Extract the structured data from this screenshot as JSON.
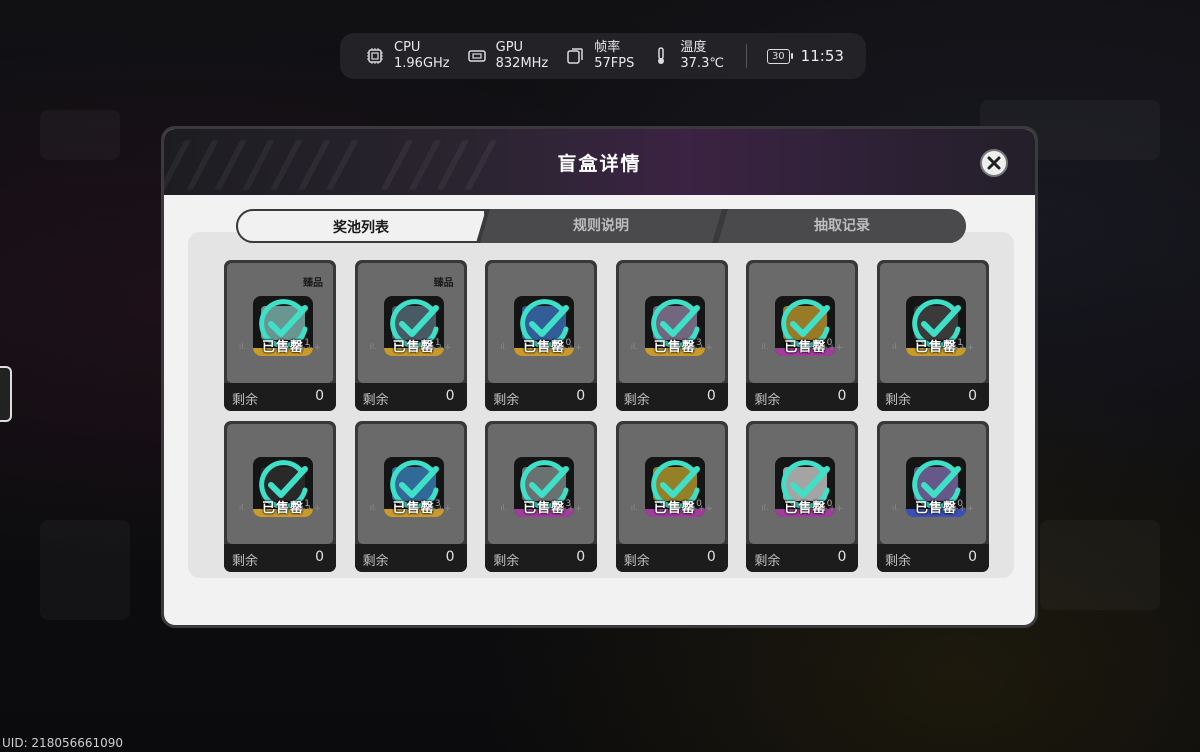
{
  "hud": {
    "cpu": {
      "label": "CPU",
      "value": "1.96GHz",
      "icon": "cpu-icon"
    },
    "gpu": {
      "label": "GPU",
      "value": "832MHz",
      "icon": "gpu-icon"
    },
    "fps": {
      "label": "帧率",
      "value": "57FPS",
      "icon": "fps-icon"
    },
    "temp": {
      "label": "温度",
      "value": "37.3℃",
      "icon": "thermometer-icon"
    },
    "battery": "30",
    "time": "11:53"
  },
  "dialog": {
    "title": "盲盒详情",
    "tabs": [
      "奖池列表",
      "规则说明",
      "抽取记录"
    ],
    "active_tab": "奖池列表",
    "remain_label": "剩余",
    "sold_label": "已售罄",
    "featured_badge": "臻品",
    "items": [
      {
        "badge": true,
        "remaining": "0",
        "color": "#7fb7b0",
        "bar": "#c99b2a",
        "level": "1"
      },
      {
        "badge": true,
        "remaining": "0",
        "color": "#556b77",
        "bar": "#c99b2a",
        "level": "1"
      },
      {
        "badge": false,
        "remaining": "0",
        "color": "#3a6fb8",
        "bar": "#c99b2a",
        "level": "0"
      },
      {
        "badge": false,
        "remaining": "0",
        "color": "#8a7c9a",
        "bar": "#c99b2a",
        "level": "3"
      },
      {
        "badge": false,
        "remaining": "0",
        "color": "#b9932c",
        "bar": "#a03c9c",
        "level": "0"
      },
      {
        "badge": false,
        "remaining": "0",
        "color": "#444444",
        "bar": "#c99b2a",
        "level": "1"
      },
      {
        "badge": false,
        "remaining": "0",
        "color": "#2e2e2e",
        "bar": "#c99b2a",
        "level": "1"
      },
      {
        "badge": false,
        "remaining": "0",
        "color": "#3a7fb8",
        "bar": "#c99b2a",
        "level": "3"
      },
      {
        "badge": false,
        "remaining": "0",
        "color": "#7f8a88",
        "bar": "#a03c9c",
        "level": "3"
      },
      {
        "badge": false,
        "remaining": "0",
        "color": "#b59a2c",
        "bar": "#a03c9c",
        "level": "0"
      },
      {
        "badge": false,
        "remaining": "0",
        "color": "#c8c8c8",
        "bar": "#a03c9c",
        "level": "0"
      },
      {
        "badge": false,
        "remaining": "0",
        "color": "#7a6aa8",
        "bar": "#3a4fb8",
        "level": "0"
      }
    ]
  },
  "uid": "UID: 218056661090"
}
